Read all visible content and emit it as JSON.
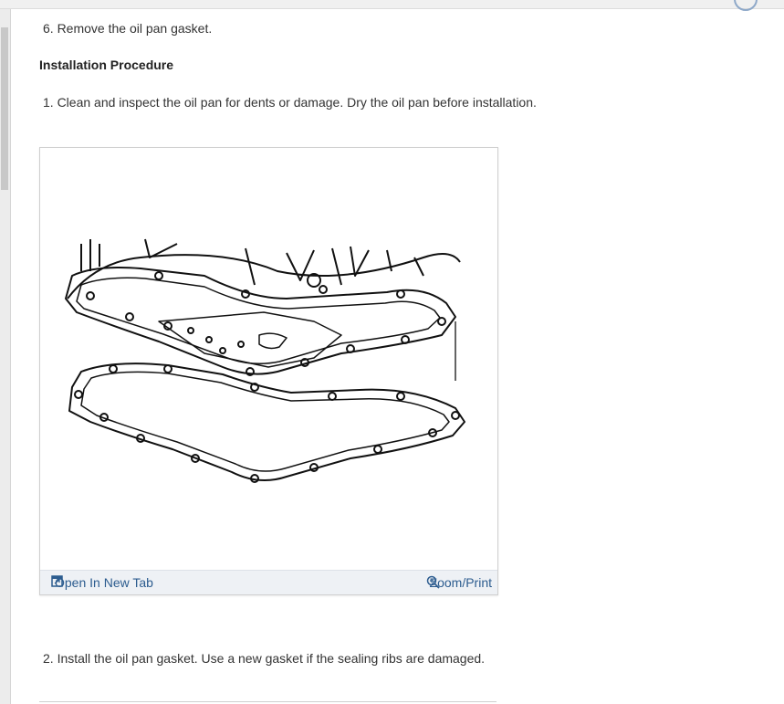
{
  "steps": {
    "step6": "6. Remove the oil pan gasket.",
    "step1": "1. Clean and inspect the oil pan for dents or damage. Dry the oil pan before installation.",
    "step2": "2. Install the oil pan gasket. Use a new gasket if the sealing ribs are damaged."
  },
  "section": {
    "title": "Installation Procedure"
  },
  "figure": {
    "open_label": "Open In New Tab",
    "zoom_label": "Zoom/Print",
    "open_icon": "open-new-tab-icon",
    "zoom_icon": "zoom-magnifier-icon"
  },
  "colors": {
    "link": "#2c5c8f",
    "text": "#333333",
    "footer_bg": "#eef1f5"
  }
}
